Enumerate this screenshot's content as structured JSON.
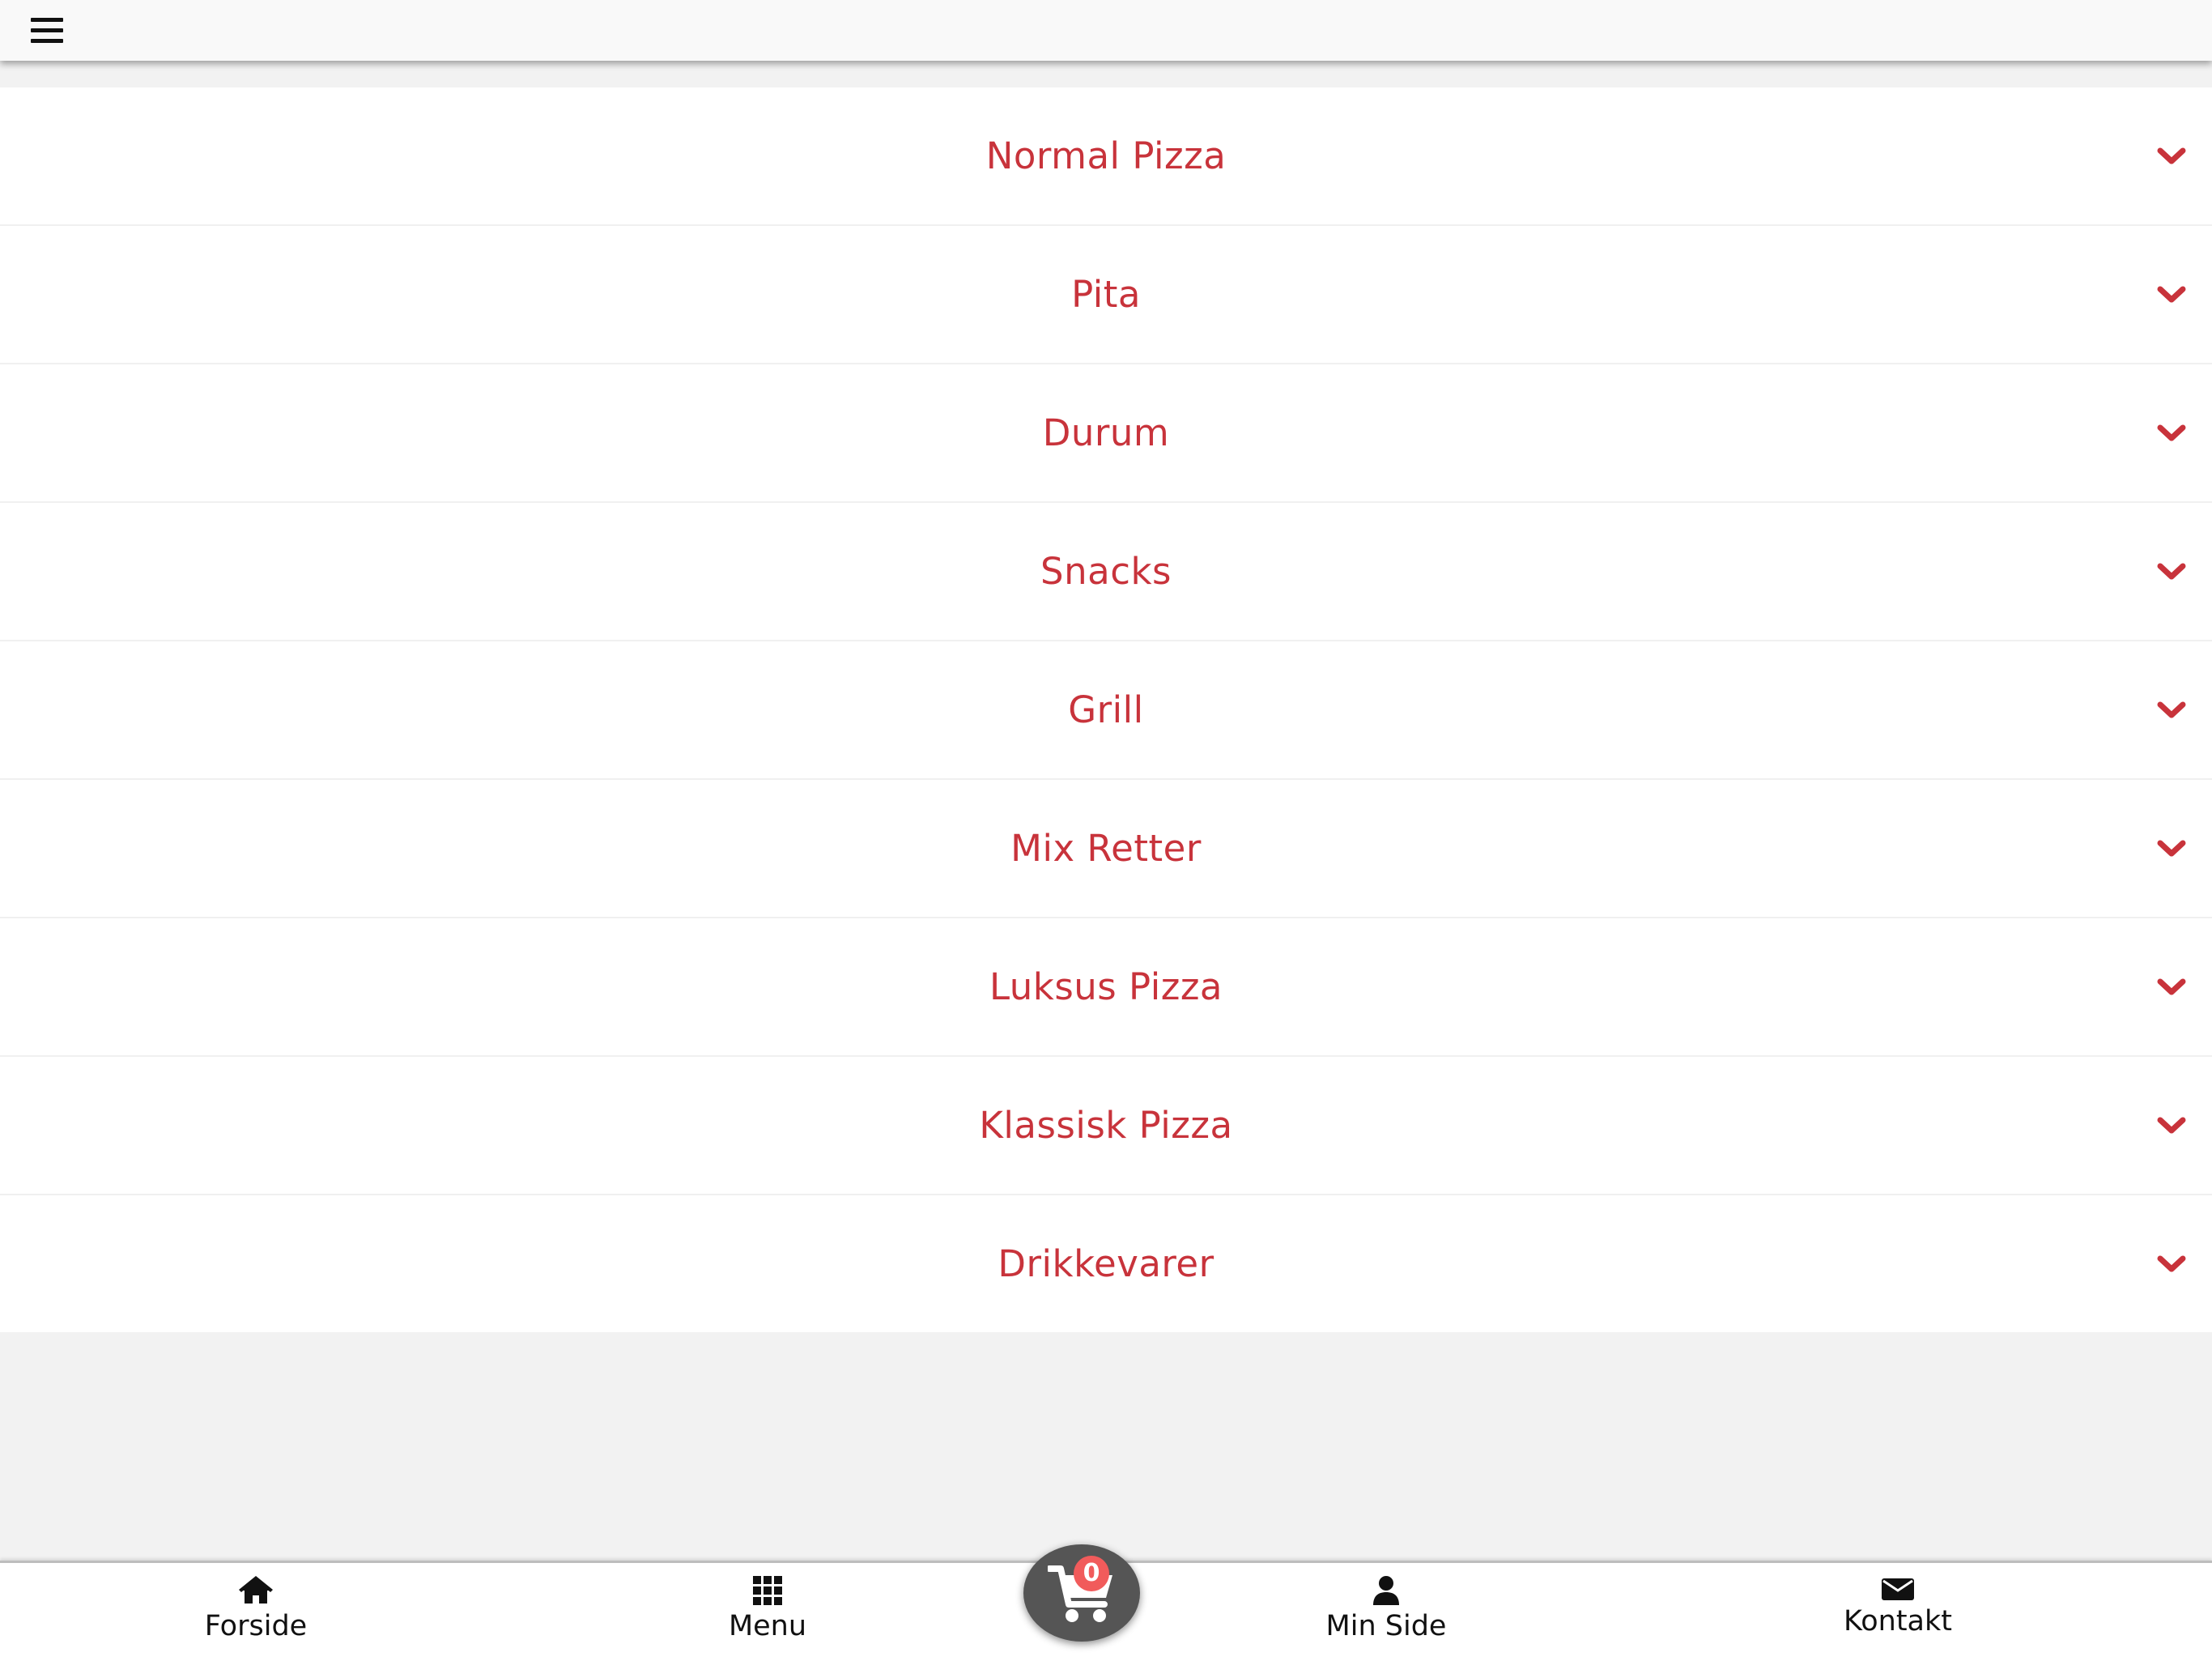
{
  "topbar": {
    "menu_icon": "hamburger-icon"
  },
  "categories": [
    {
      "label": "Normal Pizza",
      "icon": "chevron-down-icon"
    },
    {
      "label": "Pita",
      "icon": "chevron-down-icon"
    },
    {
      "label": "Durum",
      "icon": "chevron-down-icon"
    },
    {
      "label": "Snacks",
      "icon": "chevron-down-icon"
    },
    {
      "label": "Grill",
      "icon": "chevron-down-icon"
    },
    {
      "label": "Mix Retter",
      "icon": "chevron-down-icon"
    },
    {
      "label": "Luksus Pizza",
      "icon": "chevron-down-icon"
    },
    {
      "label": "Klassisk Pizza",
      "icon": "chevron-down-icon"
    },
    {
      "label": "Drikkevarer",
      "icon": "chevron-down-icon"
    }
  ],
  "bottom_nav": {
    "home": {
      "label": "Forside",
      "icon": "home-icon"
    },
    "menu": {
      "label": "Menu",
      "icon": "grid-icon"
    },
    "profile": {
      "label": "Min Side",
      "icon": "user-icon"
    },
    "contact": {
      "label": "Kontakt",
      "icon": "envelope-icon"
    }
  },
  "cart": {
    "count": "0",
    "icon": "shopping-cart-icon"
  },
  "colors": {
    "accent": "#c8333b",
    "badge": "#f15b5b",
    "cart_bg": "#555555",
    "page_bg": "#f2f2f2"
  }
}
